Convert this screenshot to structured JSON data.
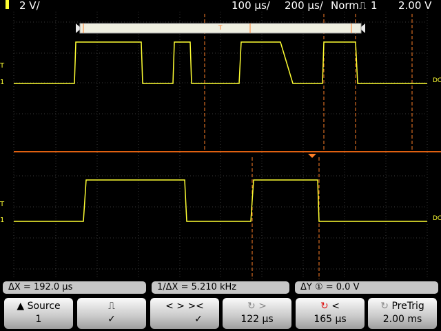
{
  "status": {
    "channel_scale": "2 V/",
    "time_scale": "100 µs/",
    "delay": "200 µs/",
    "trigger_mode": "Norm",
    "trigger_source": "1",
    "trigger_level": "2.00 V"
  },
  "markers": {
    "trigger_upper": "T",
    "ch1_upper": "1",
    "trigger_lower": "T",
    "ch1_lower": "1",
    "dc_upper": "DC",
    "dc_lower": "DC",
    "zoom_trigger": "T"
  },
  "measurements": {
    "delta_x": "ΔX = 192.0 µs",
    "inv_delta_x": "1/ΔX =  5.210 kHz",
    "delta_y": "ΔY ① =  0.0 V"
  },
  "softkeys": {
    "source_label": "Source",
    "source_value": "1",
    "mode_top": "⎍",
    "mode_check": "✓",
    "cursor_top": "<  >  ><",
    "cursor_check": "✓",
    "x1_label": ">",
    "x1_value": "122 µs",
    "x2_label": "<",
    "x2_value": "165 µs",
    "pretrig_label": "PreTrig",
    "pretrig_value": "2.00 ms"
  },
  "colors": {
    "trace": "#ffff33",
    "cursor": "#ff7f27",
    "grid": "#555555",
    "separator": "#e06010"
  }
}
